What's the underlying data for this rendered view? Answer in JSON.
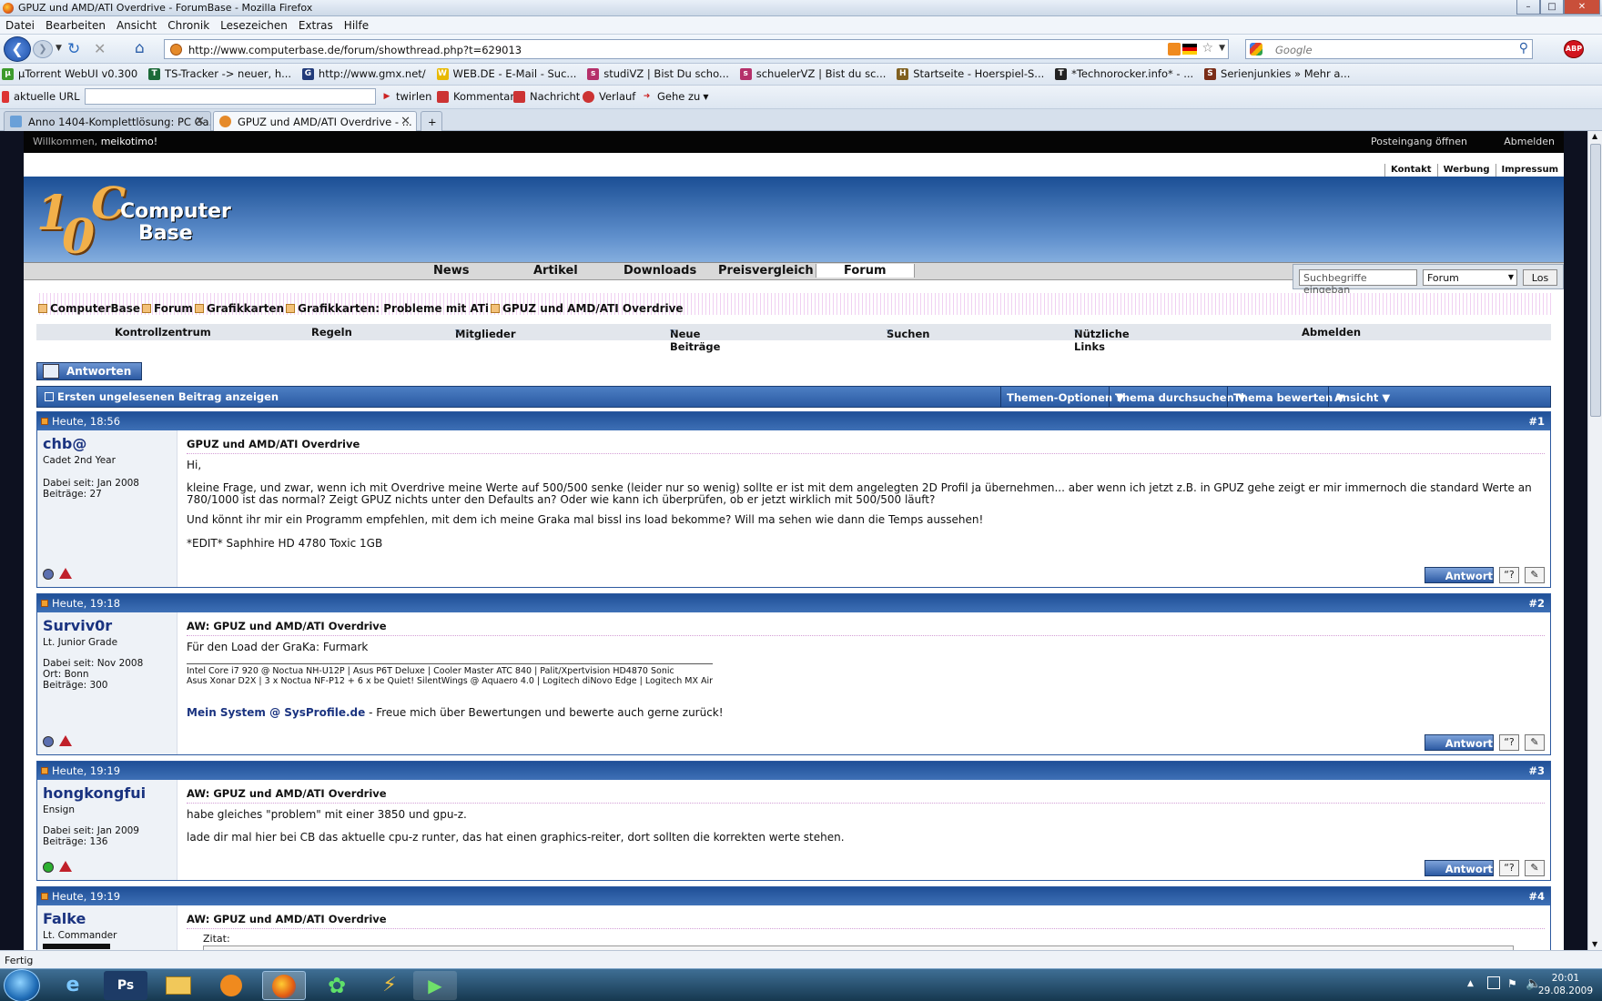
{
  "window": {
    "title": "GPUZ und AMD/ATI Overdrive - ForumBase - Mozilla Firefox"
  },
  "menu": [
    "Datei",
    "Bearbeiten",
    "Ansicht",
    "Chronik",
    "Lesezeichen",
    "Extras",
    "Hilfe"
  ],
  "nav": {
    "url": "http://www.computerbase.de/forum/showthread.php?t=629013",
    "search_placeholder": "Google"
  },
  "bookmarks": [
    {
      "label": "µTorrent WebUI v0.300",
      "color": "#3d9a2c",
      "icon": "µ"
    },
    {
      "label": "TS-Tracker -> neuer, h...",
      "color": "#1c6a38",
      "icon": "T"
    },
    {
      "label": "http://www.gmx.net/",
      "color": "#223b7a",
      "icon": "G"
    },
    {
      "label": "WEB.DE - E-Mail - Suc...",
      "color": "#e8b900",
      "icon": "W"
    },
    {
      "label": "studiVZ | Bist Du scho...",
      "color": "#b5306a",
      "icon": "s"
    },
    {
      "label": "schuelerVZ | Bist du sc...",
      "color": "#b5306a",
      "icon": "s"
    },
    {
      "label": "Startseite - Hoerspiel-S...",
      "color": "#806020",
      "icon": "H"
    },
    {
      "label": "*Technorocker.info* - ...",
      "color": "#222222",
      "icon": "T"
    },
    {
      "label": "Serienjunkies » Mehr a...",
      "color": "#7a2d18",
      "icon": "S"
    }
  ],
  "bookmarks2": {
    "url_label": "aktuelle URL",
    "items": [
      "twirlen",
      "Kommentar",
      "Nachricht",
      "Verlauf",
      "Gehe zu"
    ]
  },
  "tabs": [
    {
      "label": "Anno 1404-Komplettlösung: PC Ga..."
    },
    {
      "label": "GPUZ und AMD/ATI Overdrive - ..."
    }
  ],
  "site": {
    "welcome": "Willkommen,",
    "user": "meikotimo!",
    "inbox": "Posteingang öffnen",
    "logout": "Abmelden",
    "toplinks": [
      "Kontakt",
      "Werbung",
      "Impressum"
    ],
    "logo": {
      "num1": "1",
      "num0": "0",
      "line1": "Computer",
      "line2": "Base"
    },
    "mainnav": [
      "News",
      "Artikel",
      "Downloads",
      "Preisvergleich",
      "Forum"
    ],
    "search": {
      "placeholder": "Suchbegriffe eingeban",
      "select": "Forum",
      "go": "Los"
    },
    "breadcrumb": [
      "ComputerBase",
      "Forum",
      "Grafikkarten",
      "Grafikkarten: Probleme mit ATi",
      "GPUZ und AMD/ATI Overdrive"
    ],
    "subnav": [
      "Kontrollzentrum",
      "Regeln",
      "Mitglieder",
      "Neue Beiträge",
      "Suchen",
      "Nützliche Links",
      "Abmelden"
    ],
    "reply_button": "Antworten",
    "threadbar": {
      "first_unread": "Ersten ungelesenen Beitrag anzeigen",
      "options": [
        "Themen-Optionen",
        "Thema durchsuchen",
        "Thema bewerten",
        "Ansicht"
      ]
    }
  },
  "posts": [
    {
      "date": "Heute, 18:56",
      "num": "#1",
      "user": "chb@",
      "rank": "Cadet 2nd Year",
      "meta": [
        "Dabei seit: Jan 2008",
        "Beiträge: 27"
      ],
      "title": "GPUZ und AMD/ATI Overdrive",
      "lines": [
        "Hi,",
        "kleine Frage, und zwar, wenn ich mit Overdrive meine Werte auf 500/500 senke (leider nur so wenig) sollte er ist mit dem angelegten 2D Profil ja übernehmen... aber wenn ich jetzt z.B. in GPUZ gehe zeigt er mir immernoch die standard Werte an 780/1000 ist das normal? Zeigt GPUZ nichts unter den Defaults an? Oder wie kann ich überprüfen, ob er jetzt wirklich mit 500/500 läuft?",
        "Und könnt ihr mir ein Programm empfehlen, mit dem ich meine Graka mal bissl ins load bekomme? Will ma sehen wie dann die Temps aussehen!",
        "*EDIT* Saphhire HD 4780 Toxic 1GB"
      ],
      "button": "Antwort"
    },
    {
      "date": "Heute, 19:18",
      "num": "#2",
      "user": "Surviv0r",
      "rank": "Lt. Junior Grade",
      "meta": [
        "Dabei seit: Nov 2008",
        "Ort: Bonn",
        "Beiträge: 300"
      ],
      "title": "AW: GPUZ und AMD/ATI Overdrive",
      "lines": [
        "Für den Load der GraKa: Furmark"
      ],
      "sig": [
        "Intel Core i7 920 @ Noctua NH-U12P | Asus P6T Deluxe | Cooler Master ATC 840 | Palit/Xpertvision HD4870 Sonic",
        "Asus Xonar D2X | 3 x Noctua NF-P12 + 6 x be Quiet! SilentWings @ Aquaero 4.0 | Logitech diNovo Edge | Logitech MX Air"
      ],
      "sig_link": "Mein System @ SysProfile.de",
      "sig_text": " - Freue mich über Bewertungen und bewerte auch gerne zurück!",
      "button": "Antwort"
    },
    {
      "date": "Heute, 19:19",
      "num": "#3",
      "user": "hongkongfui",
      "rank": "Ensign",
      "meta": [
        "Dabei seit: Jan 2009",
        "Beiträge: 136"
      ],
      "title": "AW: GPUZ und AMD/ATI Overdrive",
      "lines": [
        "habe gleiches \"problem\" mit einer 3850 und gpu-z.",
        "lade dir mal hier bei CB das aktuelle cpu-z runter, das hat einen graphics-reiter, dort sollten die korrekten werte stehen."
      ],
      "button": "Antwort"
    },
    {
      "date": "Heute, 19:19",
      "num": "#4",
      "user": "Falke",
      "rank": "Lt. Commander",
      "title": "AW: GPUZ und AMD/ATI Overdrive",
      "quote": "Zitat:"
    }
  ],
  "status": "Fertig",
  "clock": {
    "time": "20:01",
    "date": "29.08.2009"
  }
}
